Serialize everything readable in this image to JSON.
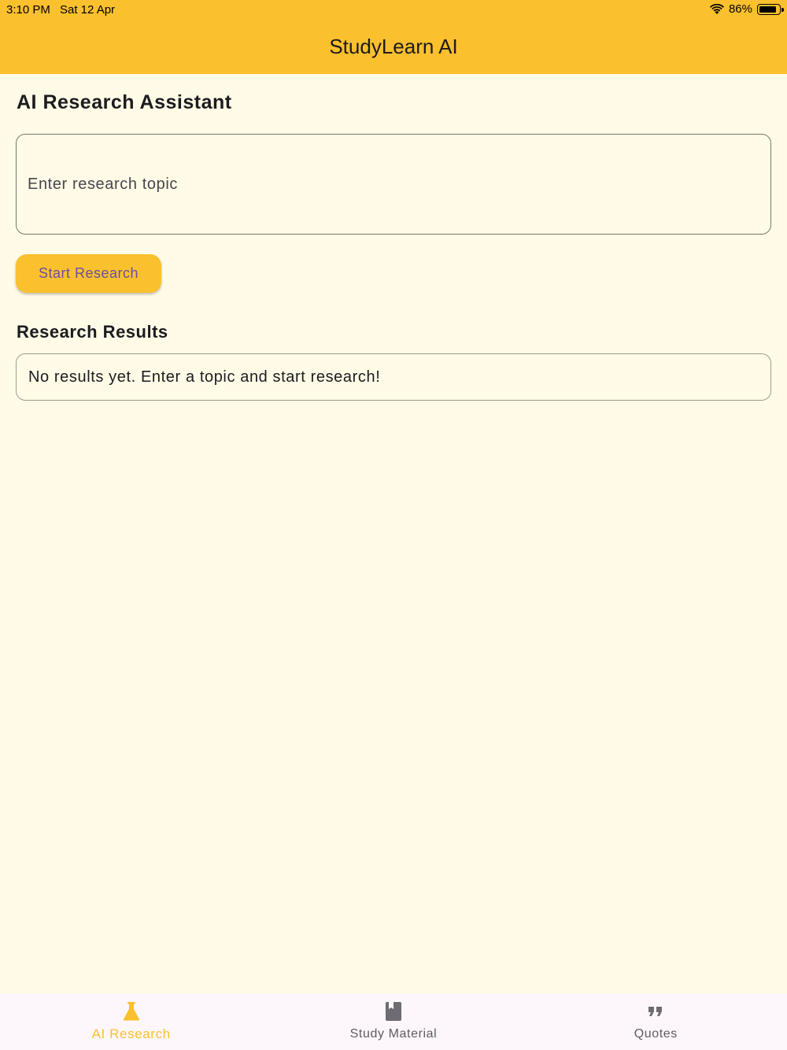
{
  "status_bar": {
    "time": "3:10 PM",
    "date": "Sat 12 Apr",
    "battery": "86%"
  },
  "app_title": "StudyLearn AI",
  "main": {
    "heading": "AI Research Assistant",
    "topic_input": {
      "placeholder": "Enter research topic",
      "value": ""
    },
    "start_button": "Start Research",
    "results_heading": "Research Results",
    "results_text": "No results yet. Enter a topic and start research!"
  },
  "bottom_nav": [
    {
      "label": "AI Research",
      "icon": "flask-icon",
      "active": true
    },
    {
      "label": "Study Material",
      "icon": "book-icon",
      "active": false
    },
    {
      "label": "Quotes",
      "icon": "quote-icon",
      "active": false
    }
  ],
  "colors": {
    "accent": "#fbc02d",
    "background": "#fffbe6",
    "button_text": "#6750a4",
    "nav_bg": "#fdf7fb"
  }
}
